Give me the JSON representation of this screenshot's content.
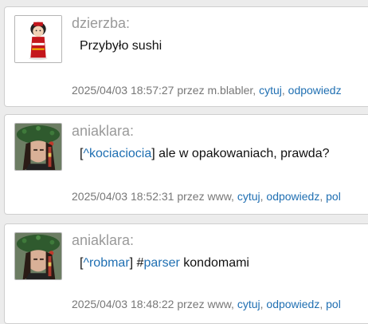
{
  "posts": [
    {
      "author": "dzierzba:",
      "content_text": "Przybyło sushi",
      "timestamp": "2025/04/03 18:57:27",
      "via": "przez m.blabler,",
      "actions": [
        "cytuj",
        "odpowiedz"
      ],
      "avatar_icon": "sushi-doll-avatar"
    },
    {
      "author": "aniaklara:",
      "mention": "^kociaciocia",
      "content_text": "ale w opakowaniach, prawda?",
      "timestamp": "2025/04/03 18:52:31",
      "via": "przez www,",
      "actions": [
        "cytuj",
        "odpowiedz",
        "pol"
      ],
      "avatar_icon": "woman-with-wreath-avatar"
    },
    {
      "author": "aniaklara:",
      "mention": "^robmar",
      "hashtag": "parser",
      "content_text": "kondomami",
      "timestamp": "2025/04/03 18:48:22",
      "via": "przez www,",
      "actions": [
        "cytuj",
        "odpowiedz",
        "pol"
      ],
      "avatar_icon": "woman-with-wreath-avatar"
    }
  ],
  "colors": {
    "link": "#1f6fb2",
    "author": "#9a9a9a",
    "meta": "#777777",
    "background": "#ececec"
  }
}
